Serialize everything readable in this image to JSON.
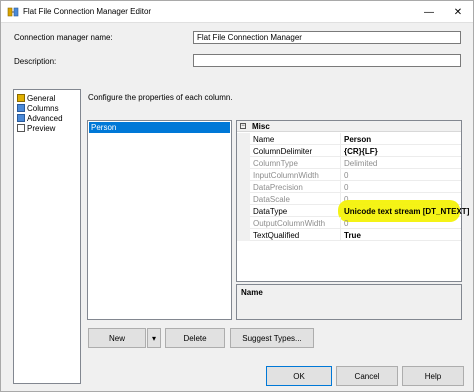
{
  "window": {
    "title": "Flat File Connection Manager Editor",
    "minimize": "—",
    "close": "✕"
  },
  "form": {
    "name_label": "Connection manager name:",
    "name_value": "Flat File Connection Manager",
    "desc_label": "Description:",
    "desc_value": "",
    "instruction": "Configure the properties of each column."
  },
  "nav": {
    "items": [
      {
        "label": "General",
        "icon": "general-icon"
      },
      {
        "label": "Columns",
        "icon": "columns-icon"
      },
      {
        "label": "Advanced",
        "icon": "advanced-icon"
      },
      {
        "label": "Preview",
        "icon": "preview-icon"
      }
    ],
    "selected": "Advanced"
  },
  "columns_list": {
    "items": [
      "Person"
    ],
    "selected": "Person"
  },
  "property_grid": {
    "category": "Misc",
    "toggle": "−",
    "rows": [
      {
        "name": "Name",
        "value": "Person",
        "enabled": true,
        "bold": true
      },
      {
        "name": "ColumnDelimiter",
        "value": "{CR}{LF}",
        "enabled": true,
        "bold": true
      },
      {
        "name": "ColumnType",
        "value": "Delimited",
        "enabled": false,
        "bold": false
      },
      {
        "name": "InputColumnWidth",
        "value": "0",
        "enabled": false,
        "bold": false
      },
      {
        "name": "DataPrecision",
        "value": "0",
        "enabled": false,
        "bold": false
      },
      {
        "name": "DataScale",
        "value": "0",
        "enabled": false,
        "bold": false
      },
      {
        "name": "DataType",
        "value": "Unicode text stream [DT_NTEXT]",
        "enabled": true,
        "bold": true,
        "highlighted": true
      },
      {
        "name": "OutputColumnWidth",
        "value": "0",
        "enabled": false,
        "bold": false
      },
      {
        "name": "TextQualified",
        "value": "True",
        "enabled": true,
        "bold": true
      }
    ]
  },
  "description_panel": {
    "title": "Name"
  },
  "buttons": {
    "new": "New",
    "new_dropdown": "▾",
    "delete": "Delete",
    "suggest": "Suggest Types...",
    "ok": "OK",
    "cancel": "Cancel",
    "help": "Help"
  },
  "colors": {
    "selection": "#0078d7",
    "highlight": "#f4f20a",
    "disabled_text": "#8d8d8d"
  }
}
